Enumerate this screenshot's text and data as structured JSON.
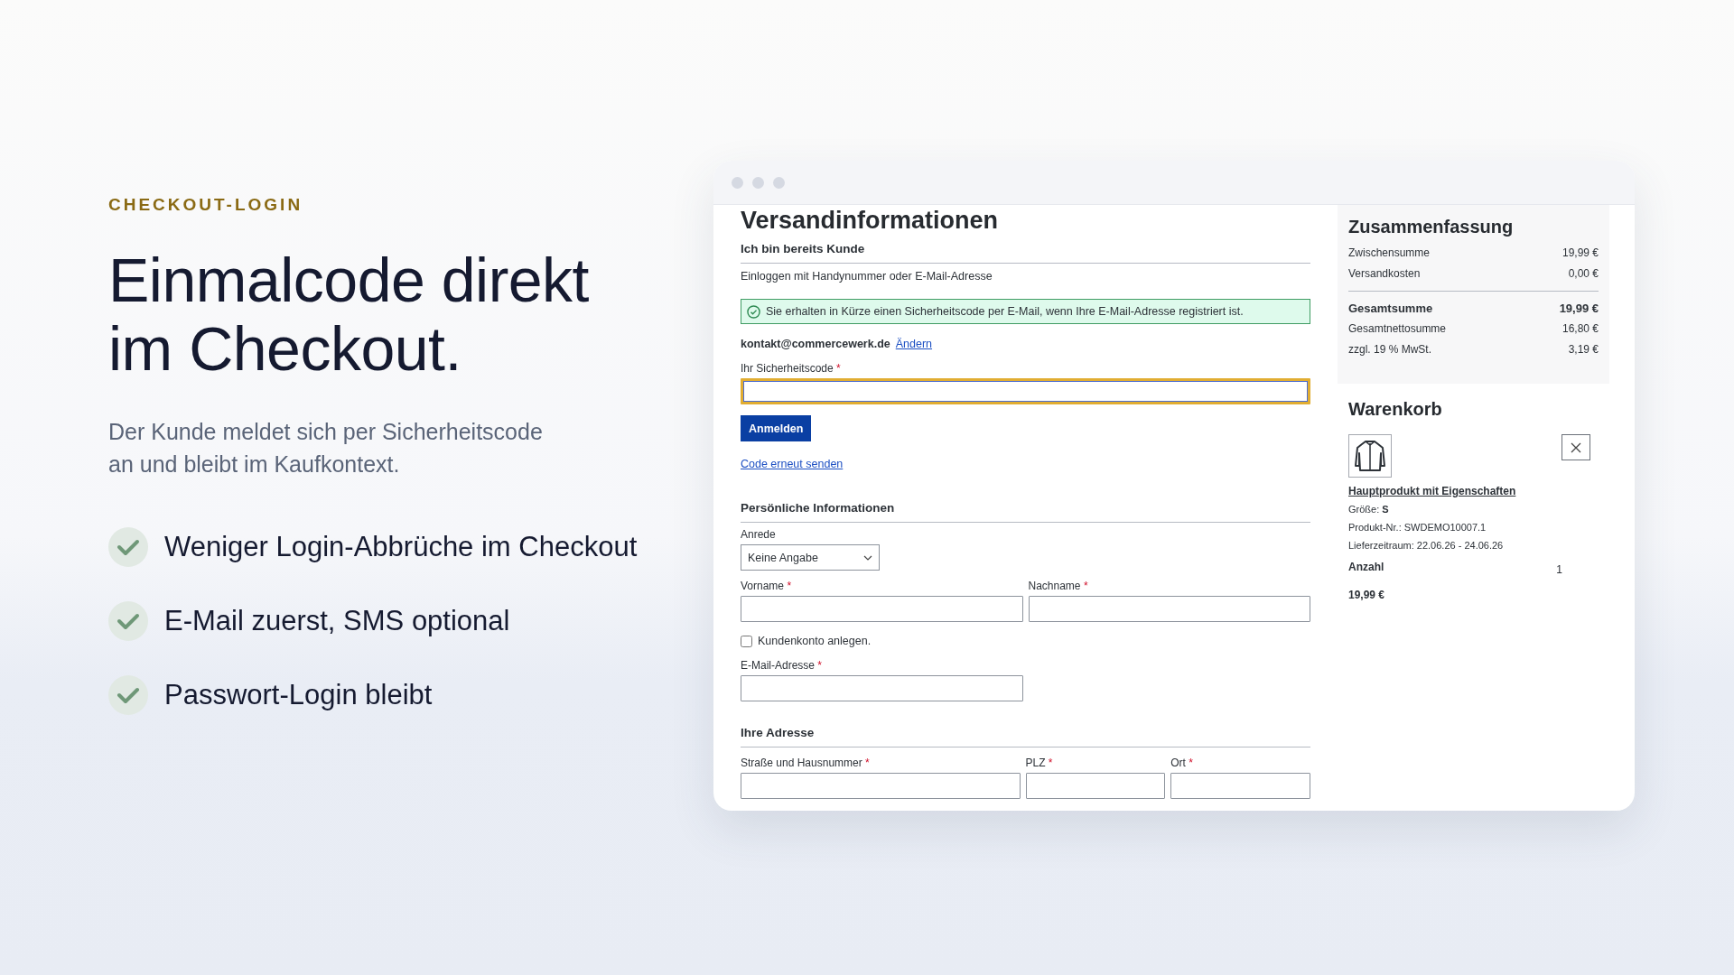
{
  "hero": {
    "eyebrow": "CHECKOUT-LOGIN",
    "headline_lines": [
      "Einmalcode direkt",
      "im Checkout."
    ],
    "subtitle_lines": [
      "Der Kunde meldet sich per Sicherheitscode",
      "an und bleibt im Kaufkontext."
    ],
    "features": [
      "Weniger Login-Abbrüche im Checkout",
      "E-Mail zuerst, SMS optional",
      "Passwort-Login bleibt"
    ]
  },
  "checkout": {
    "title": "Versandinformationen",
    "login": {
      "heading": "Ich bin bereits Kunde",
      "hint": "Einloggen mit Handynummer oder E-Mail-Adresse",
      "alert": "Sie erhalten in Kürze einen Sicherheitscode per E-Mail, wenn Ihre E-Mail-Adresse registriert ist.",
      "email": "kontakt@commercewerk.de",
      "change_link": "Ändern",
      "code_field": {
        "label": "Ihr Sicherheitscode",
        "required_mark": "*",
        "focused": true
      },
      "submit": "Anmelden",
      "resend_link": "Code erneut senden"
    },
    "personal": {
      "heading": "Persönliche Informationen",
      "salutation": {
        "label": "Anrede",
        "value": "Keine Angabe"
      },
      "name_fields": [
        {
          "label": "Vorname",
          "required_mark": "*"
        },
        {
          "label": "Nachname",
          "required_mark": "*"
        }
      ],
      "create_account": {
        "label": "Kundenkonto anlegen.",
        "checked": false
      },
      "email_field": {
        "label": "E-Mail-Adresse",
        "required_mark": "*"
      }
    },
    "address": {
      "heading": "Ihre Adresse",
      "fields": [
        {
          "label": "Straße und Hausnummer",
          "required_mark": "*"
        },
        {
          "label": "PLZ",
          "required_mark": "*"
        },
        {
          "label": "Ort",
          "required_mark": "*"
        }
      ]
    }
  },
  "summary": {
    "title": "Zusammenfassung",
    "rows": [
      {
        "kind": "line",
        "label": "Zwischensumme",
        "value": "19,99 €"
      },
      {
        "kind": "line",
        "label": "Versandkosten",
        "value": "0,00 €"
      },
      {
        "kind": "total",
        "label": "Gesamtsumme",
        "value": "19,99 €"
      },
      {
        "kind": "line",
        "label": "Gesamtnettosumme",
        "value": "16,80 €"
      },
      {
        "kind": "line",
        "label": "zzgl. 19 % MwSt.",
        "value": "3,19 €"
      }
    ]
  },
  "cart": {
    "title": "Warenkorb",
    "item": {
      "name": "Hauptprodukt mit Eigenschaften",
      "size": "Größe: **S**",
      "sku": "Produkt-Nr.: SWDEMO10007.1",
      "delivery": "Lieferzeitraum: 22.06.26 - 24.06.26",
      "quantity_label": "Anzahl",
      "quantity": "1",
      "price": "19,99 €"
    }
  }
}
